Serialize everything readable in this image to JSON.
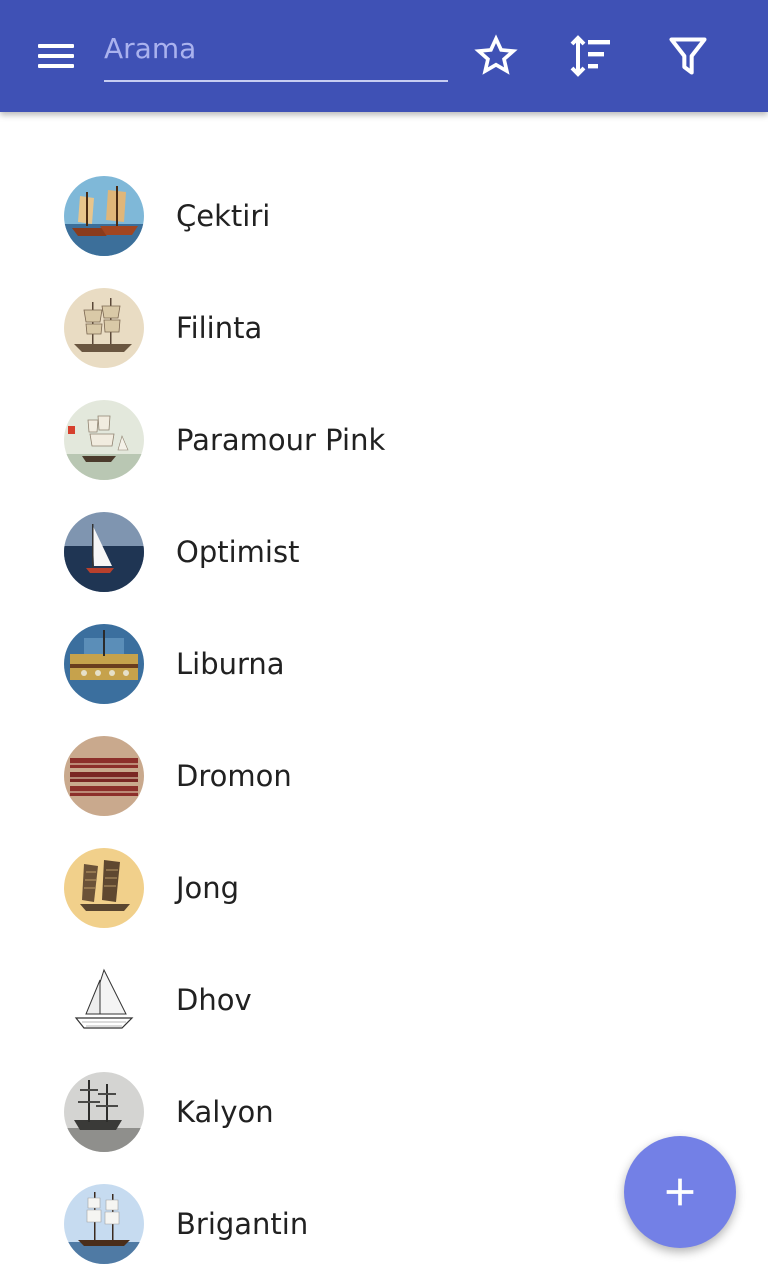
{
  "appbar": {
    "menu_icon": "menu-icon",
    "search": {
      "value": "",
      "placeholder": "Arama"
    },
    "favorite_icon": "star-outline-icon",
    "sort_icon": "sort-icon",
    "filter_icon": "filter-icon"
  },
  "colors": {
    "primary": "#3f51b5",
    "fab": "#7380e6",
    "text": "#212121"
  },
  "items": [
    {
      "label": "Çektiri"
    },
    {
      "label": "Filinta"
    },
    {
      "label": "Paramour Pink"
    },
    {
      "label": "Optimist"
    },
    {
      "label": "Liburna"
    },
    {
      "label": "Dromon"
    },
    {
      "label": "Jong"
    },
    {
      "label": "Dhov"
    },
    {
      "label": "Kalyon"
    },
    {
      "label": "Brigantin"
    }
  ],
  "fab": {
    "icon": "plus-icon"
  }
}
